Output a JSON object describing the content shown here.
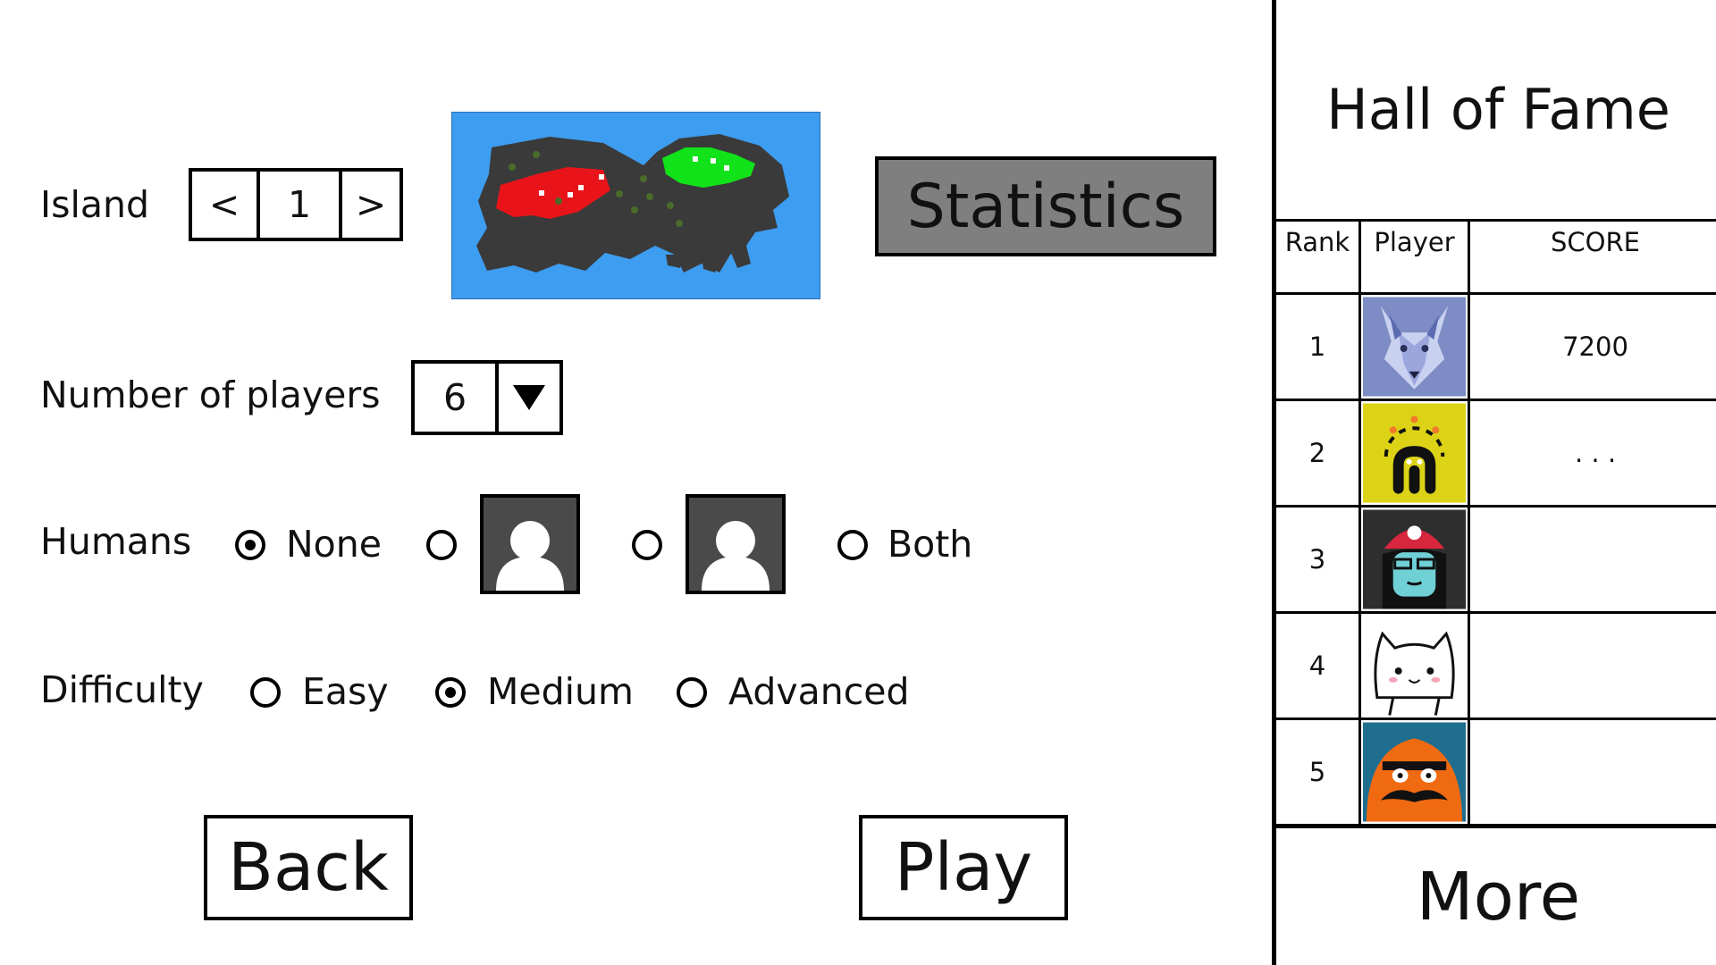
{
  "island": {
    "label": "Island",
    "prev": "<",
    "value": "1",
    "next": ">"
  },
  "statistics_label": "Statistics",
  "players": {
    "label": "Number of players",
    "value": "6"
  },
  "humans": {
    "label": "Humans",
    "options": [
      "None",
      "",
      "",
      "Both"
    ],
    "selected": "None"
  },
  "difficulty": {
    "label": "Difficulty",
    "options": [
      "Easy",
      "Medium",
      "Advanced"
    ],
    "selected": "Medium"
  },
  "back_label": "Back",
  "play_label": "Play",
  "hall_of_fame": {
    "title": "Hall of Fame",
    "headers": {
      "rank": "Rank",
      "player": "Player",
      "score": "SCORE"
    },
    "rows": [
      {
        "rank": "1",
        "avatar": "wolf-avatar",
        "score": "7200"
      },
      {
        "rank": "2",
        "avatar": "octopus-avatar",
        "score": ". . ."
      },
      {
        "rank": "3",
        "avatar": "skull-hat-girl-avatar",
        "score": ""
      },
      {
        "rank": "4",
        "avatar": "cat-avatar",
        "score": ""
      },
      {
        "rank": "5",
        "avatar": "mustache-blob-avatar",
        "score": ""
      }
    ],
    "more_label": "More"
  },
  "colors": {
    "ocean": "#3d9df0",
    "land": "#3a3a3a",
    "red_territory": "#e8141a",
    "green_territory": "#12e21a",
    "statistics_bg": "#7f7f7f"
  }
}
